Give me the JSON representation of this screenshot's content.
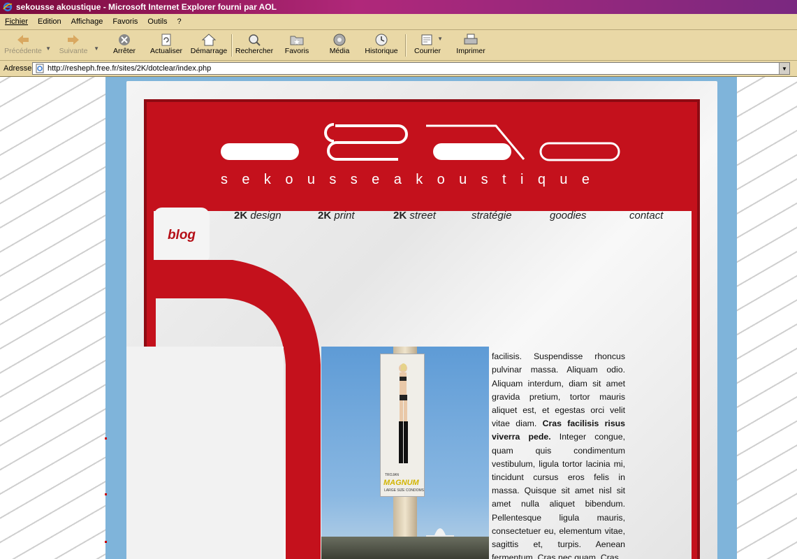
{
  "window": {
    "title": "sekousse akoustique - Microsoft Internet Explorer fourni par AOL"
  },
  "menu": [
    "Fichier",
    "Edition",
    "Affichage",
    "Favoris",
    "Outils",
    "?"
  ],
  "toolbar": {
    "back": "Précédente",
    "forward": "Suivante",
    "stop": "Arrêter",
    "refresh": "Actualiser",
    "home": "Démarrage",
    "search": "Rechercher",
    "favorites": "Favoris",
    "media": "Média",
    "history": "Historique",
    "mail": "Courrier",
    "print": "Imprimer"
  },
  "address": {
    "label": "Adresse",
    "url": "http://resheph.free.fr/sites/2K/dotclear/index.php"
  },
  "site": {
    "brand": "sekousseakoustique",
    "nav": [
      {
        "bold": "2K",
        "italic": "design"
      },
      {
        "bold": "2K",
        "italic": "print"
      },
      {
        "bold": "2K",
        "italic": "street"
      },
      {
        "bold": "",
        "italic": "stratégie"
      },
      {
        "bold": "",
        "italic": "goodies"
      },
      {
        "bold": "",
        "italic": "contact"
      }
    ],
    "blog": "blog",
    "banner_brand": "MAGNUM",
    "banner_top": "TROJAN",
    "banner_small": "LARGE SIZE CONDOMS",
    "article": {
      "p1": "Cras nisl sit amet nisl tincidunt facilisis. Suspendisse rhoncus pulvinar massa. Aliquam odio. Aliquam interdum, diam sit amet gravida pretium, tortor mauris aliquet est, et egestas orci velit vitae diam.",
      "strong": "Cras facilisis risus viverra pede.",
      "p2": "Integer congue, quam quis condimentum vestibulum, ligula tortor lacinia mi, tincidunt cursus eros felis in massa. Quisque sit amet nisl sit amet nulla aliquet bibendum. Pellentesque ligula mauris, consectetuer eu, elementum vitae, sagittis et, turpis. Aenean fermentum. Cras nec quam. Cras"
    }
  }
}
